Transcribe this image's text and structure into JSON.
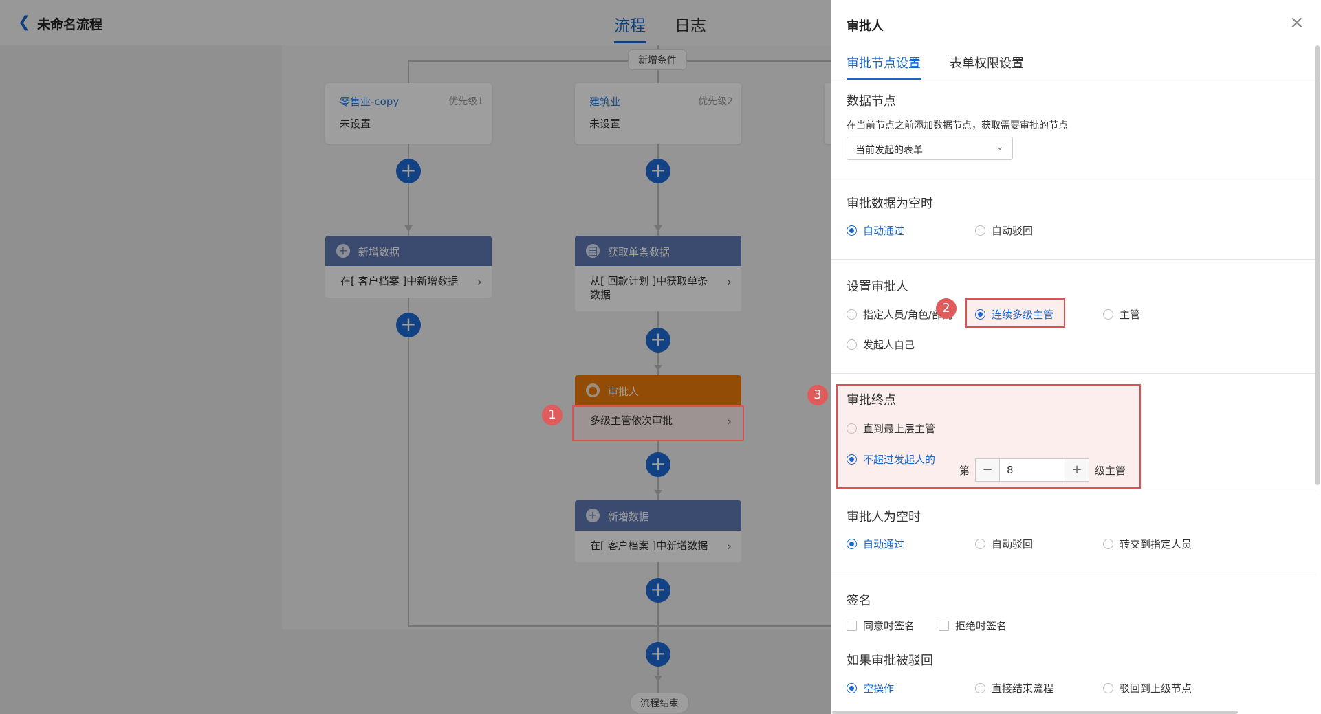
{
  "header": {
    "back_icon": "chevron-left-icon",
    "title": "未命名流程",
    "tabs": [
      "流程",
      "日志"
    ]
  },
  "flow": {
    "add_condition": "新增条件",
    "branches": [
      {
        "name": "零售业-copy",
        "priority": "优先级1",
        "value": "未设置"
      },
      {
        "name": "建筑业",
        "priority": "优先级2",
        "value": "未设置"
      }
    ],
    "nodes": {
      "left_add": {
        "title": "新增数据",
        "body": "在[ 客户档案 ]中新增数据"
      },
      "mid_fetch": {
        "title": "获取单条数据",
        "body": "从[ 回款计划 ]中获取单条数据"
      },
      "approver": {
        "title": "审批人",
        "body": "多级主管依次审批"
      },
      "mid_add": {
        "title": "新增数据",
        "body": "在[ 客户档案 ]中新增数据"
      }
    },
    "end": "流程结束",
    "plus": "+",
    "chevron": "›"
  },
  "badges": [
    "1",
    "2",
    "3"
  ],
  "panel": {
    "title": "审批人",
    "close": "×",
    "tabs": [
      "审批节点设置",
      "表单权限设置"
    ],
    "data_node": {
      "title": "数据节点",
      "hint": "在当前节点之前添加数据节点，获取需要审批的节点",
      "select": "当前发起的表单"
    },
    "empty_data": {
      "title": "审批数据为空时",
      "options": [
        "自动通过",
        "自动驳回"
      ],
      "selected": "自动通过"
    },
    "set_approver": {
      "title": "设置审批人",
      "options": [
        "指定人员/角色/部门",
        "连续多级主管",
        "主管",
        "发起人自己"
      ],
      "selected": "连续多级主管"
    },
    "endpoint": {
      "title": "审批终点",
      "options": [
        "直到最上层主管",
        "不超过发起人的"
      ],
      "selected": "不超过发起人的",
      "prefix": "第",
      "minus": "−",
      "value": "8",
      "plus": "+",
      "suffix": "级主管"
    },
    "empty_approver": {
      "title": "审批人为空时",
      "options": [
        "自动通过",
        "自动驳回",
        "转交到指定人员"
      ],
      "selected": "自动通过"
    },
    "signature": {
      "title": "签名",
      "options": [
        "同意时签名",
        "拒绝时签名"
      ]
    },
    "rejected": {
      "title": "如果审批被驳回",
      "options": [
        "空操作",
        "直接结束流程",
        "驳回到上级节点"
      ],
      "selected": "空操作"
    }
  },
  "colors": {
    "accent": "#1a66cc",
    "node_header": "#5f79b5",
    "approver_header": "#ec7b0b",
    "highlight": "#e05050"
  }
}
